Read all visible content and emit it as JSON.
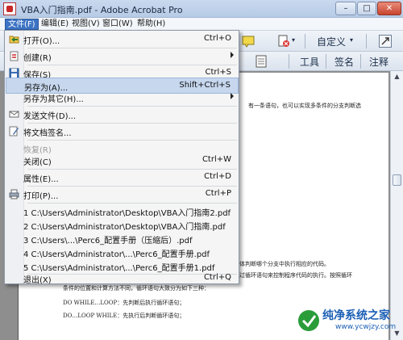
{
  "window": {
    "title": "VBA入门指南.pdf - Adobe Acrobat Pro",
    "minimize": "–",
    "maximize": "□",
    "close": "✕"
  },
  "menubar": {
    "items": [
      "文件(F)",
      "编辑(E)",
      "视图(V)",
      "窗口(W)",
      "帮助(H)"
    ],
    "active_index": 0
  },
  "toolbar": {
    "customize_label": "自定义",
    "panel_tabs": [
      "工具",
      "签名",
      "注释"
    ]
  },
  "file_menu": {
    "items": [
      {
        "label": "打开(O)...",
        "shortcut": "Ctrl+O",
        "icon": "open-folder-icon"
      },
      {
        "label": "创建(R)",
        "submenu": true,
        "icon": "create-pdf-icon"
      },
      {
        "label": "保存(S)",
        "shortcut": "Ctrl+S",
        "icon": "save-disk-icon"
      },
      {
        "label": "另存为(A)...",
        "shortcut": "Shift+Ctrl+S",
        "highlighted": true
      },
      {
        "label": "另存为其它(H)...",
        "submenu": true
      },
      {
        "label": "发送文件(D)...",
        "icon": "send-mail-icon"
      },
      {
        "label": "将文档签名...",
        "icon": "sign-document-icon"
      },
      {
        "label": "恢复(R)",
        "disabled": true
      },
      {
        "label": "关闭(C)",
        "shortcut": "Ctrl+W"
      },
      {
        "label": "属性(E)...",
        "shortcut": "Ctrl+D"
      },
      {
        "label": "打印(P)...",
        "shortcut": "Ctrl+P",
        "icon": "printer-icon"
      },
      {
        "label": "1 C:\\Users\\Administrator\\Desktop\\VBA入门指南2.pdf"
      },
      {
        "label": "2 C:\\Users\\Administrator\\Desktop\\VBA入门指南.pdf"
      },
      {
        "label": "3 C:\\Users\\...\\Perc6_配置手册（压缩后）.pdf"
      },
      {
        "label": "4 C:\\Users\\Administrator\\...\\Perc6_配置手册.pdf"
      },
      {
        "label": "5 C:\\Users\\Administrator\\...\\Perc6_配置手册1.pdf"
      },
      {
        "label": "退出(X)",
        "shortcut": "Ctrl+Q"
      }
    ]
  },
  "document": {
    "lines": [
      "有一条语句，也可以实现多条件的分支判断选",
      "体判断哪个分支中执行相应的代码。",
      "过循环语句来控制程序代码的执行。按照循环",
      "条件的位置和计算方法不同，循环语句大致分为如下三种：",
      "DO WHILE…LOOP：先判断后执行循环语句；",
      "DO…LOOP WHILE：先执行后判断循环语句；"
    ]
  },
  "watermark": {
    "title": "纯净系统之家",
    "url": "www.ycwjzy.com"
  },
  "colors": {
    "menu_highlight": "#3d74c4",
    "row_highlight": "#c6d7ee",
    "accent_pdf_red": "#c82828"
  }
}
